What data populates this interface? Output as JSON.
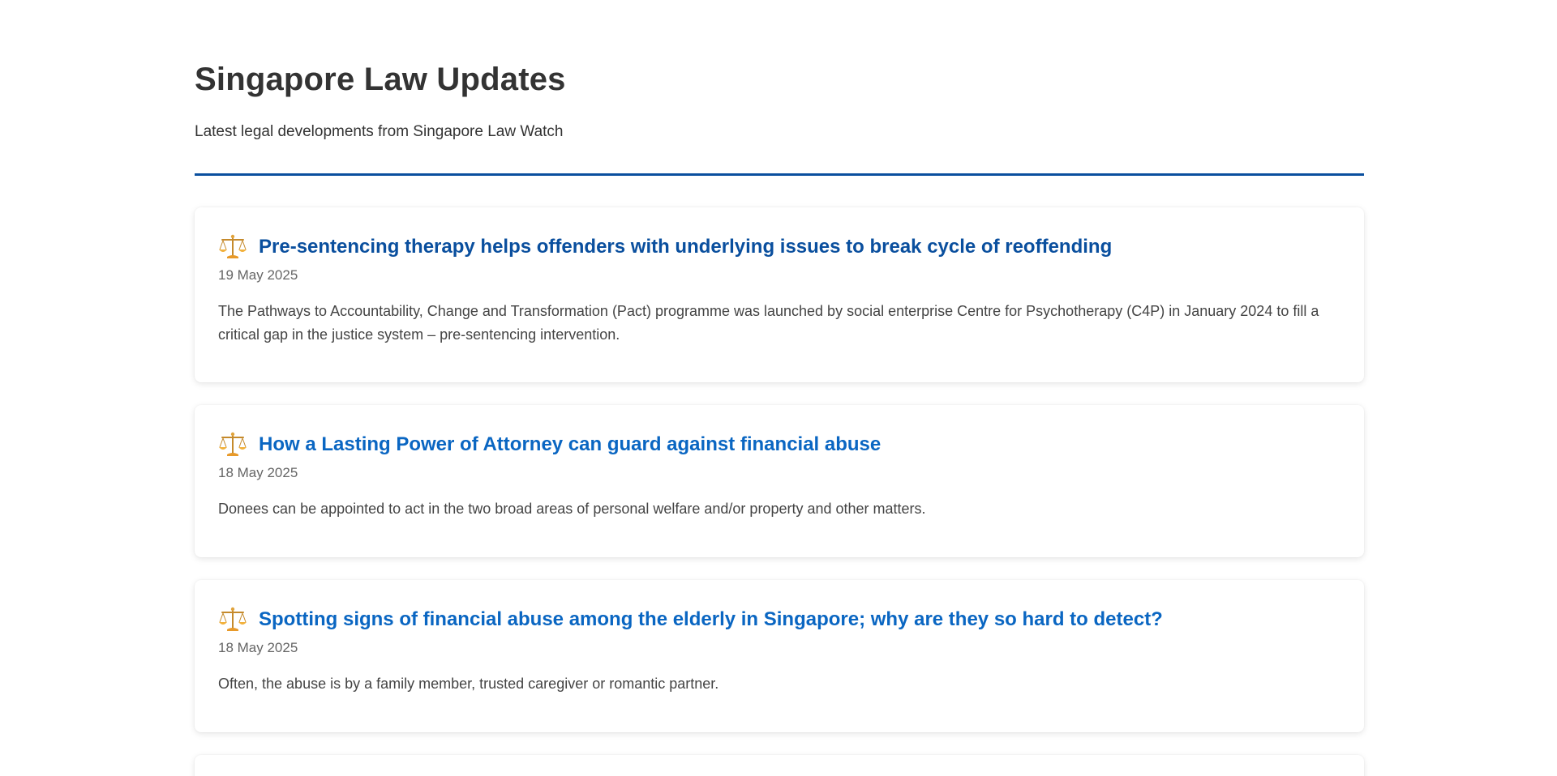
{
  "header": {
    "title": "Singapore Law Updates",
    "subtitle": "Latest legal developments from Singapore Law Watch"
  },
  "colors": {
    "accent": "#0a4f9e",
    "link": "#0a66c2",
    "text": "#333333",
    "muted": "#666666"
  },
  "articles": [
    {
      "icon": "scales-icon",
      "title": "Pre-sentencing therapy helps offenders with underlying issues to break cycle of reoffending",
      "date": "19 May 2025",
      "summary": "The Pathways to Accountability, Change and Transformation (Pact) programme was launched by social enterprise Centre for Psychotherapy (C4P) in January 2024 to fill a critical gap in the justice system – pre-sentencing intervention."
    },
    {
      "icon": "scales-icon",
      "title": "How a Lasting Power of Attorney can guard against financial abuse",
      "date": "18 May 2025",
      "summary": "Donees can be appointed to act in the two broad areas of personal welfare and/or property and other matters."
    },
    {
      "icon": "scales-icon",
      "title": "Spotting signs of financial abuse among the elderly in Singapore; why are they so hard to detect?",
      "date": "18 May 2025",
      "summary": "Often, the abuse is by a family member, trusted caregiver or romantic partner."
    }
  ]
}
